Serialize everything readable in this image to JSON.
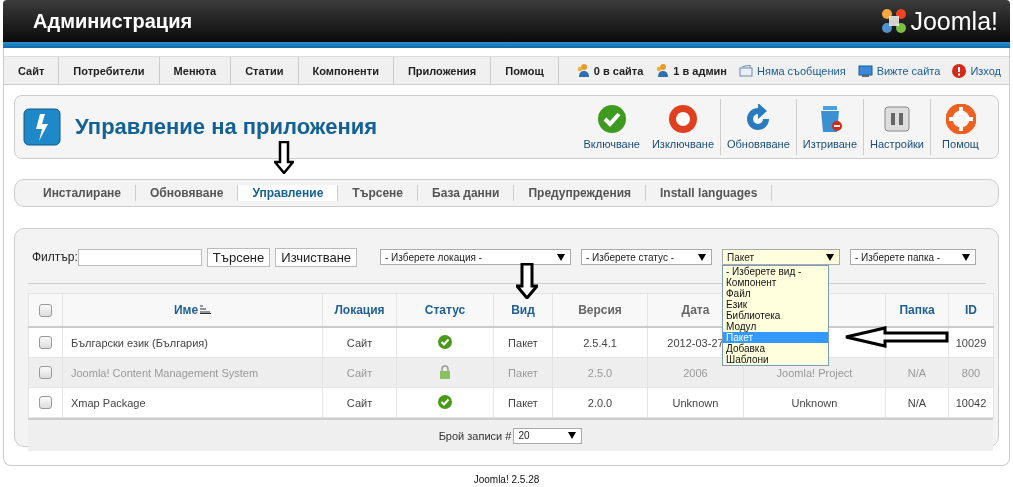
{
  "header": {
    "title": "Администрация",
    "logo_text": "Joomla!"
  },
  "menu": [
    "Сайт",
    "Потребители",
    "Менюта",
    "Статии",
    "Компоненти",
    "Приложения",
    "Помощ"
  ],
  "status_links": [
    {
      "label": "0 в сайта",
      "kind": "user"
    },
    {
      "label": "1 в админ",
      "kind": "user"
    },
    {
      "label": "Няма съобщения",
      "kind": "mail"
    },
    {
      "label": "Вижте сайта",
      "kind": "screen"
    },
    {
      "label": "Изход",
      "kind": "exit"
    }
  ],
  "page_title": "Управление на приложения",
  "toolbar": [
    "Включване",
    "Изключване",
    "Обновяване",
    "Изтриване",
    "Настройки",
    "Помощ"
  ],
  "subnav": [
    {
      "label": "Инсталиране",
      "selected": false
    },
    {
      "label": "Обновяване",
      "selected": false
    },
    {
      "label": "Управление",
      "selected": true
    },
    {
      "label": "Търсене",
      "selected": false
    },
    {
      "label": "База данни",
      "selected": false
    },
    {
      "label": "Предупреждения",
      "selected": false
    },
    {
      "label": "Install languages",
      "selected": false
    }
  ],
  "filter": {
    "label": "Филтър:",
    "search_button": "Търсене",
    "clear_button": "Изчистване"
  },
  "selects": [
    {
      "value": "- Изберете локация -",
      "open": false
    },
    {
      "value": "- Изберете статус -",
      "open": false
    },
    {
      "value": "Пакет",
      "open": true,
      "options": [
        {
          "label": "- Изберете вид -",
          "selected": false
        },
        {
          "label": "Компонент",
          "selected": false
        },
        {
          "label": "Файл",
          "selected": false
        },
        {
          "label": "Език",
          "selected": false
        },
        {
          "label": "Библиотека",
          "selected": false
        },
        {
          "label": "Модул",
          "selected": false
        },
        {
          "label": "Пакет",
          "selected": true
        },
        {
          "label": "Добавка",
          "selected": false
        },
        {
          "label": "Шаблони",
          "selected": false
        }
      ]
    },
    {
      "value": "- Изберете папка -",
      "open": false
    }
  ],
  "table": {
    "select_all": {
      "checked": false
    },
    "columns": [
      {
        "label": "Име",
        "sortable": true,
        "sorted": true
      },
      {
        "label": "Локация",
        "sortable": true
      },
      {
        "label": "Статус",
        "sortable": true
      },
      {
        "label": "Вид",
        "sortable": true
      },
      {
        "label": "Версия",
        "sortable": false
      },
      {
        "label": "Дата",
        "sortable": false
      },
      {
        "sortable": false
      },
      {
        "label": "Папка",
        "sortable": true
      },
      {
        "label": "ID",
        "sortable": true
      }
    ],
    "rows": [
      {
        "checked": false,
        "protected": false,
        "locked": false,
        "cells": [
          "Български език (България)",
          "Сайт",
          "",
          "Пакет",
          "2.5.4.1",
          "2012-03-27",
          "",
          "",
          "10029"
        ]
      },
      {
        "checked": false,
        "protected": true,
        "locked": true,
        "cells": [
          "Joomla! Content Management System",
          "Сайт",
          "",
          "Пакет",
          "2.5.0",
          "2006",
          "Joomla! Project",
          "N/A",
          "800"
        ]
      },
      {
        "checked": false,
        "protected": false,
        "locked": false,
        "cells": [
          "Xmap Package",
          "Сайт",
          "",
          "Пакет",
          "2.0.0",
          "Unknown",
          "Unknown",
          "N/A",
          "10042"
        ]
      }
    ]
  },
  "pagination": {
    "label": "Брой записи #",
    "value": "20"
  },
  "footer": "Joomla! 2.5.28"
}
